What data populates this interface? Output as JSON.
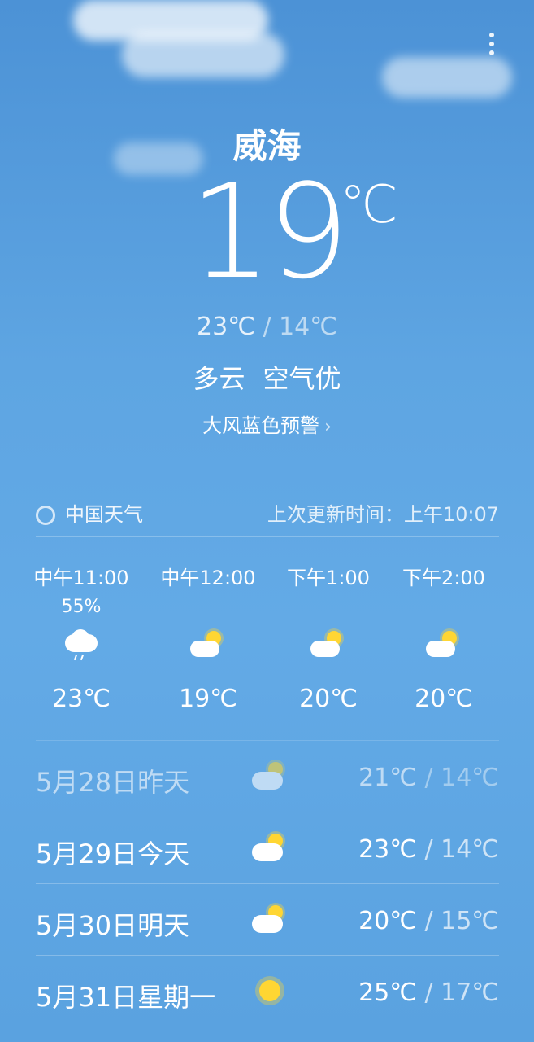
{
  "location": {
    "city": "威海"
  },
  "current": {
    "temp": "19",
    "unit": "℃",
    "high": "23℃",
    "sep": " / ",
    "low": "14℃",
    "condition": "多云",
    "air": "空气优",
    "alert": "大风蓝色预警"
  },
  "source": {
    "name": "中国天气",
    "updated": "上次更新时间：上午10:07"
  },
  "hourly": [
    {
      "time": "中午11:00",
      "pop": "55%",
      "icon": "rain-cloud-icon",
      "temp": "23℃"
    },
    {
      "time": "中午12:00",
      "pop": "",
      "icon": "partly-cloudy-icon",
      "temp": "19℃"
    },
    {
      "time": "下午1:00",
      "pop": "",
      "icon": "partly-cloudy-icon",
      "temp": "20℃"
    },
    {
      "time": "下午2:00",
      "pop": "",
      "icon": "partly-cloudy-icon",
      "temp": "20℃"
    }
  ],
  "daily": [
    {
      "date": "5月28日昨天",
      "icon": "partly-cloudy-icon",
      "high": "21℃",
      "low": "14℃"
    },
    {
      "date": "5月29日今天",
      "icon": "partly-cloudy-icon",
      "high": "23℃",
      "low": "14℃"
    },
    {
      "date": "5月30日明天",
      "icon": "partly-cloudy-icon",
      "high": "20℃",
      "low": "15℃"
    },
    {
      "date": "5月31日星期一",
      "icon": "sunny-icon",
      "high": "25℃",
      "low": "17℃"
    }
  ],
  "colors": {
    "sky_top": "#4c92d6",
    "sky_bottom": "#5aa2e0",
    "sun": "#ffd633"
  }
}
